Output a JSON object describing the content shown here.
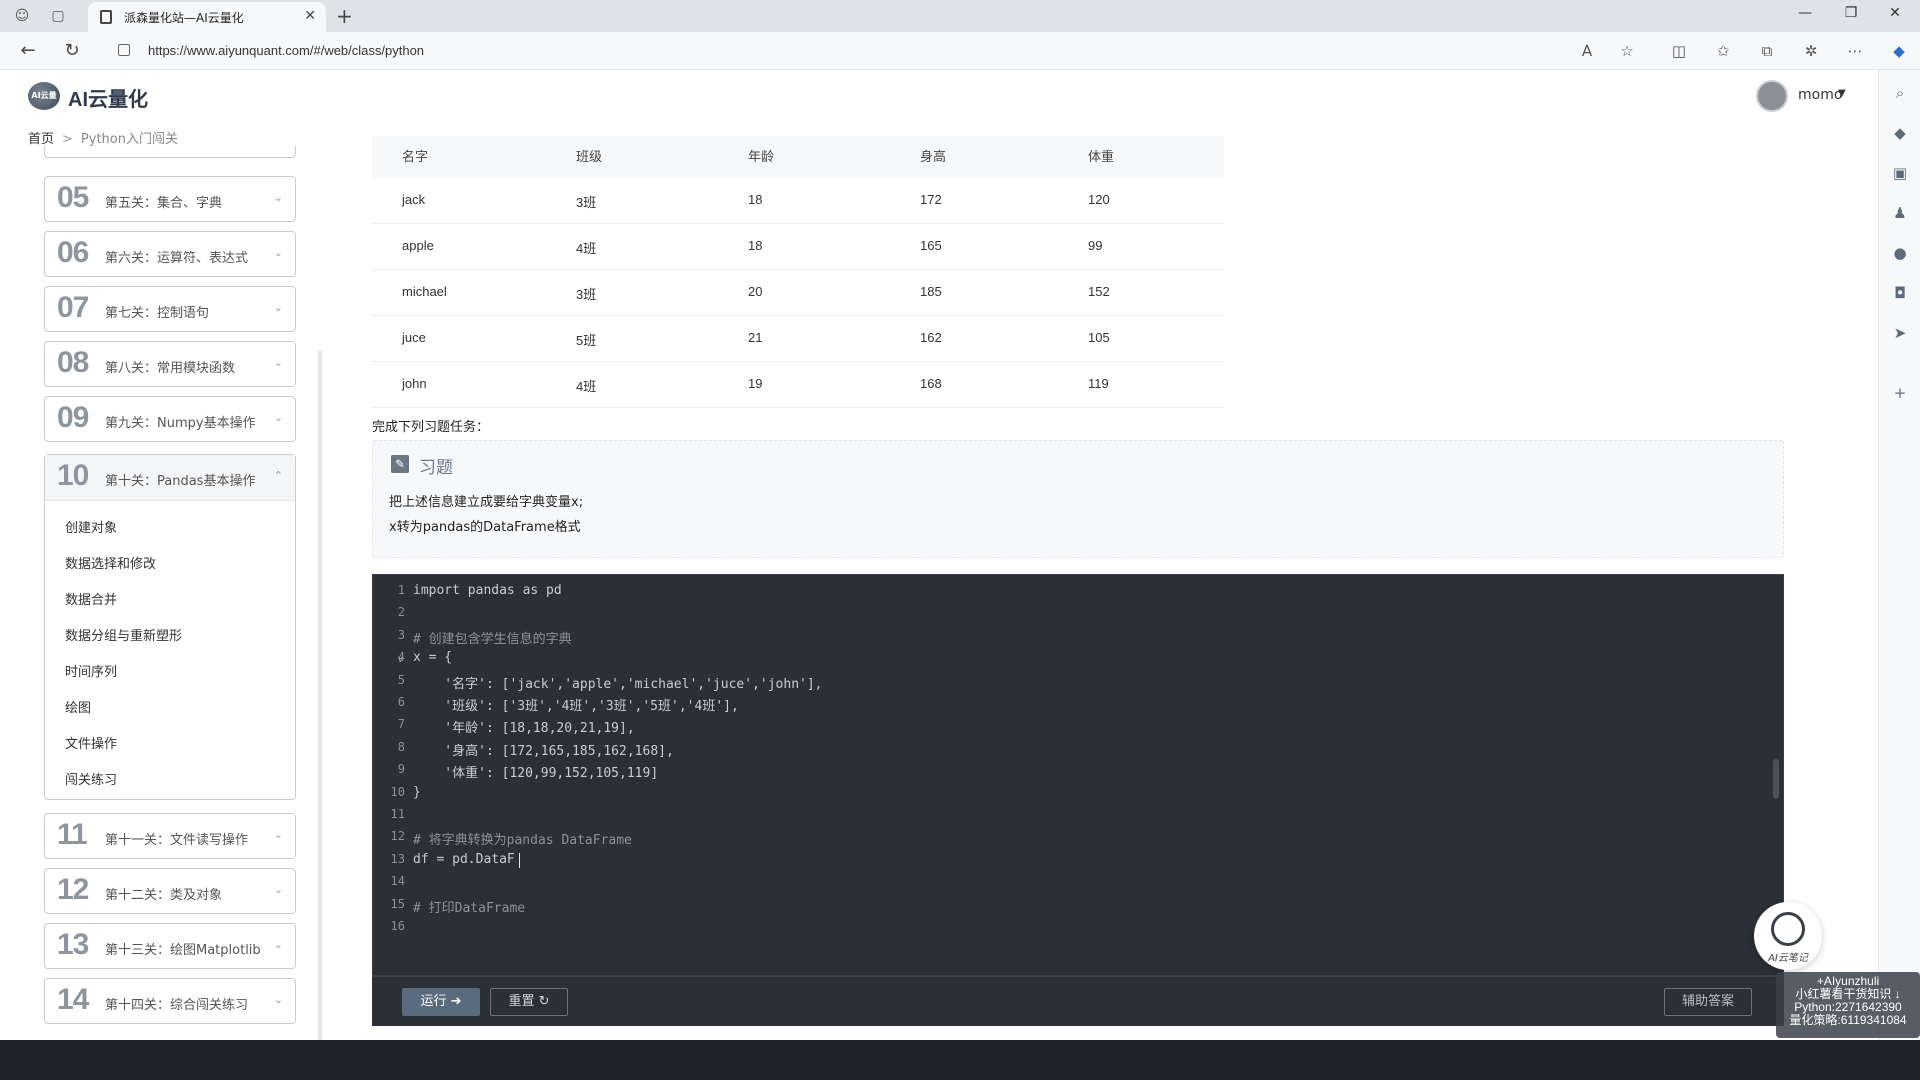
{
  "browser": {
    "tab_title": "派森量化站—AI云量化",
    "url": "https://www.aiyunquant.com/#/web/class/python"
  },
  "header": {
    "logo_text": "AI云量化",
    "logo_mark": "AI云量化",
    "user_name": "momo"
  },
  "breadcrumb": {
    "home": "首页",
    "current": "Python入门闯关"
  },
  "levels": [
    {
      "num": "05",
      "title": "第五关：集合、字典"
    },
    {
      "num": "06",
      "title": "第六关：运算符、表达式"
    },
    {
      "num": "07",
      "title": "第七关：控制语句"
    },
    {
      "num": "08",
      "title": "第八关：常用模块函数"
    },
    {
      "num": "09",
      "title": "第九关：Numpy基本操作"
    }
  ],
  "open_level": {
    "num": "10",
    "title": "第十关：Pandas基本操作",
    "items": [
      "创建对象",
      "数据选择和修改",
      "数据合并",
      "数据分组与重新塑形",
      "时间序列",
      "绘图",
      "文件操作",
      "闯关练习"
    ]
  },
  "levels_after": [
    {
      "num": "11",
      "title": "第十一关：文件读写操作"
    },
    {
      "num": "12",
      "title": "第十二关：类及对象"
    },
    {
      "num": "13",
      "title": "第十三关：绘图Matplotlib"
    },
    {
      "num": "14",
      "title": "第十四关：综合闯关练习"
    }
  ],
  "table": {
    "headers": [
      "名字",
      "班级",
      "年龄",
      "身高",
      "体重"
    ],
    "rows": [
      [
        "jack",
        "3班",
        "18",
        "172",
        "120"
      ],
      [
        "apple",
        "4班",
        "18",
        "165",
        "99"
      ],
      [
        "michael",
        "3班",
        "20",
        "185",
        "152"
      ],
      [
        "juce",
        "5班",
        "21",
        "162",
        "105"
      ],
      [
        "john",
        "4班",
        "19",
        "168",
        "119"
      ]
    ]
  },
  "task_label": "完成下列习题任务：",
  "exercise": {
    "title": "习题",
    "lines": [
      "把上述信息建立成要给字典变量x;",
      "x转为pandas的DataFrame格式"
    ]
  },
  "code_lines": [
    "import pandas as pd",
    "",
    "# 创建包含学生信息的字典",
    "x = {",
    "    '名字': ['jack','apple','michael','juce','john'],",
    "    '班级': ['3班','4班','3班','5班','4班'],",
    "    '年龄': [18,18,20,21,19],",
    "    '身高': [172,165,185,162,168],",
    "    '体重': [120,99,152,105,119]",
    "}",
    "",
    "# 将字典转换为pandas DataFrame",
    "df = pd.DataF",
    "",
    "# 打印DataFrame",
    ""
  ],
  "buttons": {
    "run": "运行 ➜",
    "reset": "重置 ↻",
    "answer": "辅助答案"
  },
  "ai_float_label": "AI云笔记",
  "watermark_lines": [
    "+AIyunzhuli",
    "小红薯看干货知识 ↓",
    "Python:2271642390",
    "量化策略:6119341084"
  ],
  "colors": {
    "editor_bg": "#2b2f36",
    "accent": "#5a6b80"
  }
}
